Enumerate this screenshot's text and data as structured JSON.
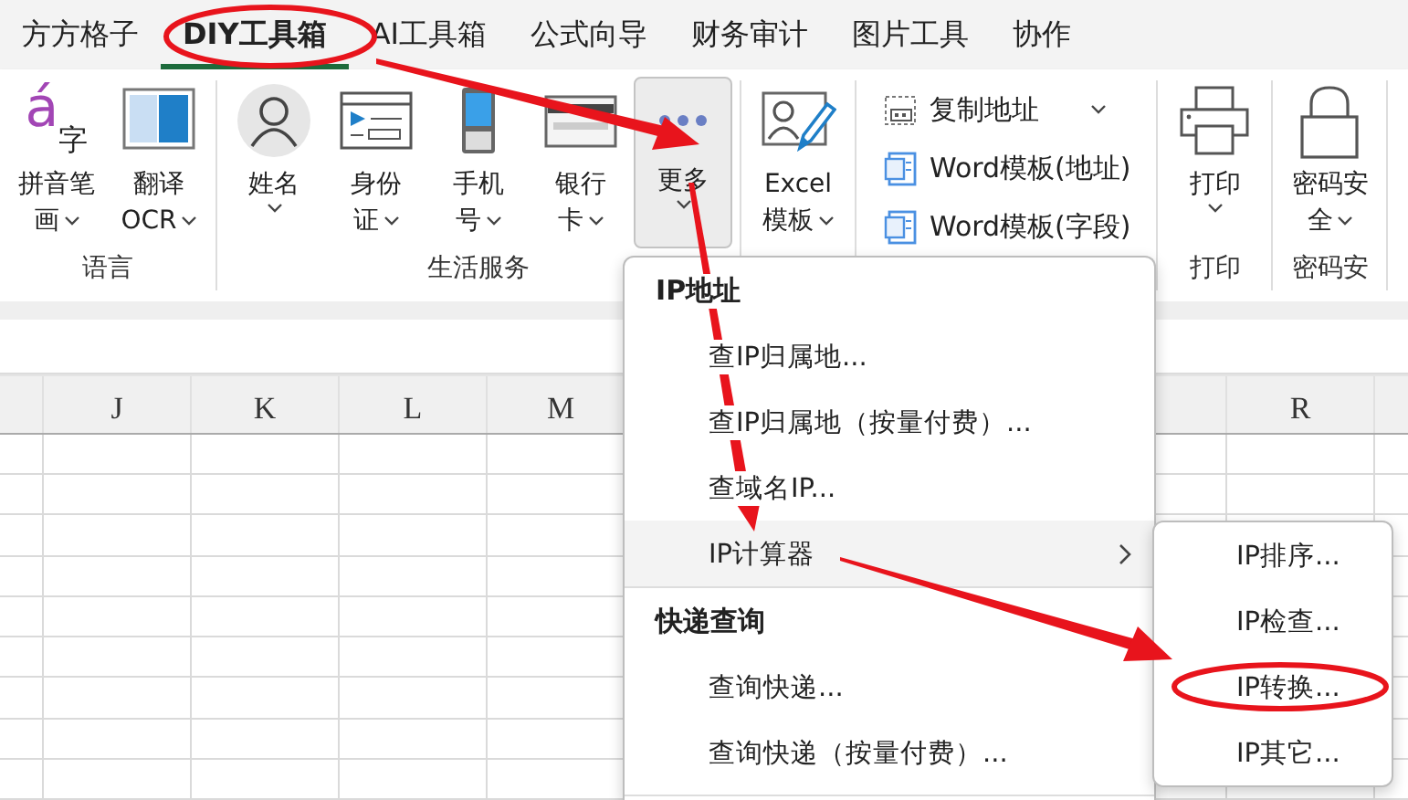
{
  "tabs": [
    {
      "label": "方方格子",
      "selected": false
    },
    {
      "label": "DIY工具箱",
      "selected": true
    },
    {
      "label": "AI工具箱",
      "selected": false
    },
    {
      "label": "公式向导",
      "selected": false
    },
    {
      "label": "财务审计",
      "selected": false
    },
    {
      "label": "图片工具",
      "selected": false
    },
    {
      "label": "协作",
      "selected": false
    }
  ],
  "ribbon_groups": [
    {
      "label": "语言",
      "items": [
        {
          "kind": "large",
          "glyph": [
            "á",
            "字"
          ],
          "lines": [
            "拼音笔",
            "画"
          ],
          "dropdown": true,
          "pressed": false
        },
        {
          "kind": "large",
          "lines": [
            "翻译",
            "OCR"
          ],
          "dropdown": true,
          "pressed": false
        }
      ]
    },
    {
      "label": "生活服务",
      "items": [
        {
          "kind": "large",
          "lines": [
            "姓名"
          ],
          "dropdown": true,
          "pressed": false
        },
        {
          "kind": "large",
          "lines": [
            "身份",
            "证"
          ],
          "dropdown": true,
          "pressed": false
        },
        {
          "kind": "large",
          "lines": [
            "手机",
            "号"
          ],
          "dropdown": true,
          "pressed": false
        },
        {
          "kind": "large",
          "lines": [
            "银行",
            "卡"
          ],
          "dropdown": true,
          "pressed": false
        },
        {
          "kind": "large",
          "lines": [
            "更多"
          ],
          "dropdown": true,
          "pressed": true
        }
      ]
    },
    {
      "items": [
        {
          "kind": "large",
          "lines": [
            "Excel",
            "模板"
          ],
          "dropdown": true,
          "pressed": false
        }
      ]
    },
    {
      "items": [
        {
          "kind": "small",
          "label": "复制地址",
          "dropdown": true
        },
        {
          "kind": "small",
          "label": "Word模板(地址)",
          "dropdown": false
        },
        {
          "kind": "small",
          "label": "Word模板(字段)",
          "dropdown": false
        }
      ]
    },
    {
      "label": "打印",
      "items": [
        {
          "kind": "large",
          "lines": [
            "打印"
          ],
          "dropdown": true,
          "pressed": false
        }
      ]
    },
    {
      "label": "密码安",
      "items": [
        {
          "kind": "large",
          "lines": [
            "密码安",
            "全"
          ],
          "dropdown": true,
          "pressed": false
        }
      ]
    }
  ],
  "columns": [
    {
      "label": "J",
      "after_gap": false
    },
    {
      "label": "K",
      "after_gap": false
    },
    {
      "label": "L",
      "after_gap": false
    },
    {
      "label": "M",
      "after_gap": false
    },
    {
      "label": "R",
      "after_gap": true
    }
  ],
  "menu": {
    "items": [
      {
        "kind": "header",
        "label": "IP地址",
        "highlighted": false
      },
      {
        "kind": "item",
        "label": "查IP归属地...",
        "highlighted": false
      },
      {
        "kind": "item",
        "label": "查IP归属地（按量付费）...",
        "highlighted": false
      },
      {
        "kind": "item",
        "label": "查域名IP...",
        "highlighted": false
      },
      {
        "kind": "submenu",
        "label": "IP计算器",
        "highlighted": true
      },
      {
        "kind": "header",
        "label": "快递查询",
        "highlighted": false
      },
      {
        "kind": "item",
        "label": "查询快递...",
        "highlighted": false
      },
      {
        "kind": "item",
        "label": "查询快递（按量付费）...",
        "highlighted": false
      }
    ]
  },
  "submenu": {
    "items": [
      {
        "label": "IP排序..."
      },
      {
        "label": "IP检查..."
      },
      {
        "label": "IP转换..."
      },
      {
        "label": "IP其它..."
      }
    ]
  }
}
